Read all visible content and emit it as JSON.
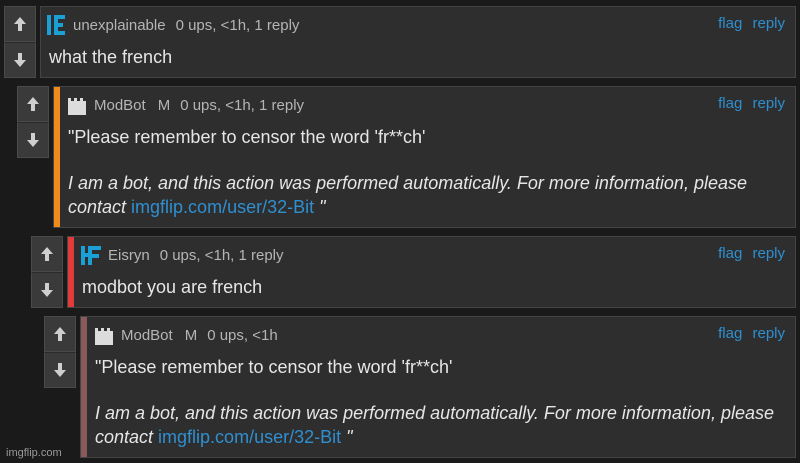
{
  "colors": {
    "accent_orange": "#f08a1a",
    "accent_red": "#e23b3b",
    "accent_brown": "#8a5a5a",
    "link_blue": "#2f8fd0",
    "avatar_blue": "#1a9fd6"
  },
  "comments": [
    {
      "username": "unexplainable",
      "badge": "",
      "meta": "0 ups, <1h, 1 reply",
      "flag": "flag",
      "reply": "reply",
      "text": "what the french"
    },
    {
      "username": "ModBot",
      "badge": "M",
      "meta": "0 ups, <1h, 1 reply",
      "flag": "flag",
      "reply": "reply",
      "quote": "\"Please remember to censor the word 'fr**ch'",
      "bot_text": "I am a bot, and this action was performed automatically. For more information, please contact ",
      "bot_link": "imgflip.com/user/32-Bit",
      "bot_end": " \""
    },
    {
      "username": "Eisryn",
      "badge": "",
      "meta": "0 ups, <1h, 1 reply",
      "flag": "flag",
      "reply": "reply",
      "text": "modbot you are french"
    },
    {
      "username": "ModBot",
      "badge": "M",
      "meta": "0 ups, <1h",
      "flag": "flag",
      "reply": "reply",
      "quote": "\"Please remember to censor the word 'fr**ch'",
      "bot_text": "I am a bot, and this action was performed automatically. For more information, please contact ",
      "bot_link": "imgflip.com/user/32-Bit",
      "bot_end": " \""
    }
  ],
  "watermark": "imgflip.com"
}
